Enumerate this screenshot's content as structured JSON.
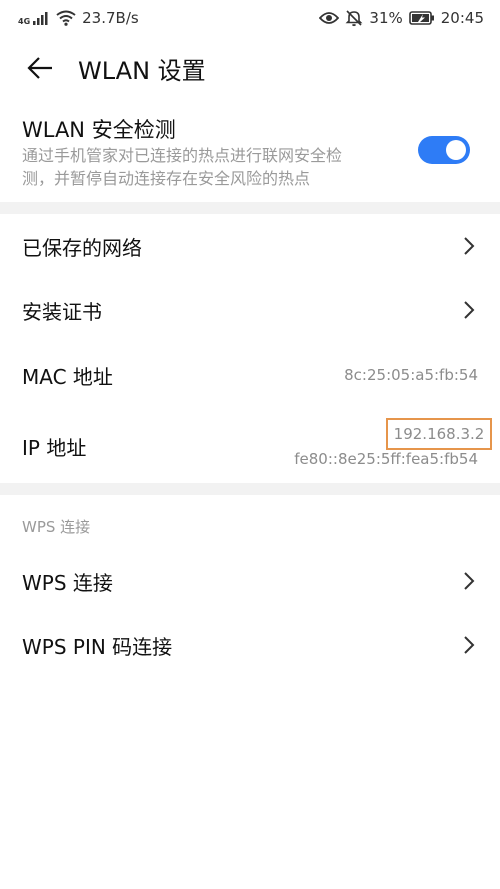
{
  "status_bar": {
    "network_type": "4G",
    "speed": "23.7B/s",
    "battery_percent": "31%",
    "time": "20:45",
    "icons": [
      "signal-icon",
      "wifi-icon",
      "eye-icon",
      "mute-icon",
      "battery-icon"
    ]
  },
  "app_bar": {
    "title": "WLAN 设置",
    "back_icon": "back-arrow-icon"
  },
  "security": {
    "title": "WLAN 安全检测",
    "description_line1": "通过手机管家对已连接的热点进行联网安全检",
    "description_line2": "测，并暂停自动连接存在安全风险的热点",
    "enabled": true,
    "accent": "#2e7cf6"
  },
  "rows": {
    "saved_networks": "已保存的网络",
    "install_cert": "安装证书",
    "mac_label": "MAC 地址",
    "mac_value": "8c:25:05:a5:fb:54",
    "ip_label": "IP 地址",
    "ipv4": "192.168.3.2",
    "ipv6": "fe80::8e25:5ff:fea5:fb54"
  },
  "wps": {
    "section_title": "WPS 连接",
    "wps_connect": "WPS 连接",
    "wps_pin_connect": "WPS PIN 码连接"
  },
  "highlight_color": "#e6954b"
}
